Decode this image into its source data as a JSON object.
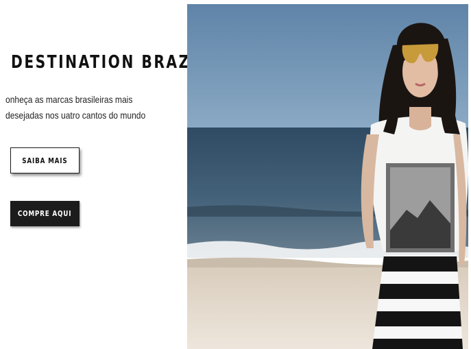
{
  "banner": {
    "title": "DESTINATION BRAZIL",
    "subtitle": "onheça as marcas brasileiras mais desejadas nos uatro cantos do mundo",
    "learn_more_label": "SAIBA MAIS",
    "shop_label": "COMPRE AQUI"
  },
  "hero_image": {
    "icon": "beach-model-photo",
    "colors": {
      "sky": "#6d8fb0",
      "sea": "#3f5d73",
      "sand": "#e7ddd0",
      "top": "#f2f2f2",
      "skirt_stripe": "#141414"
    }
  }
}
